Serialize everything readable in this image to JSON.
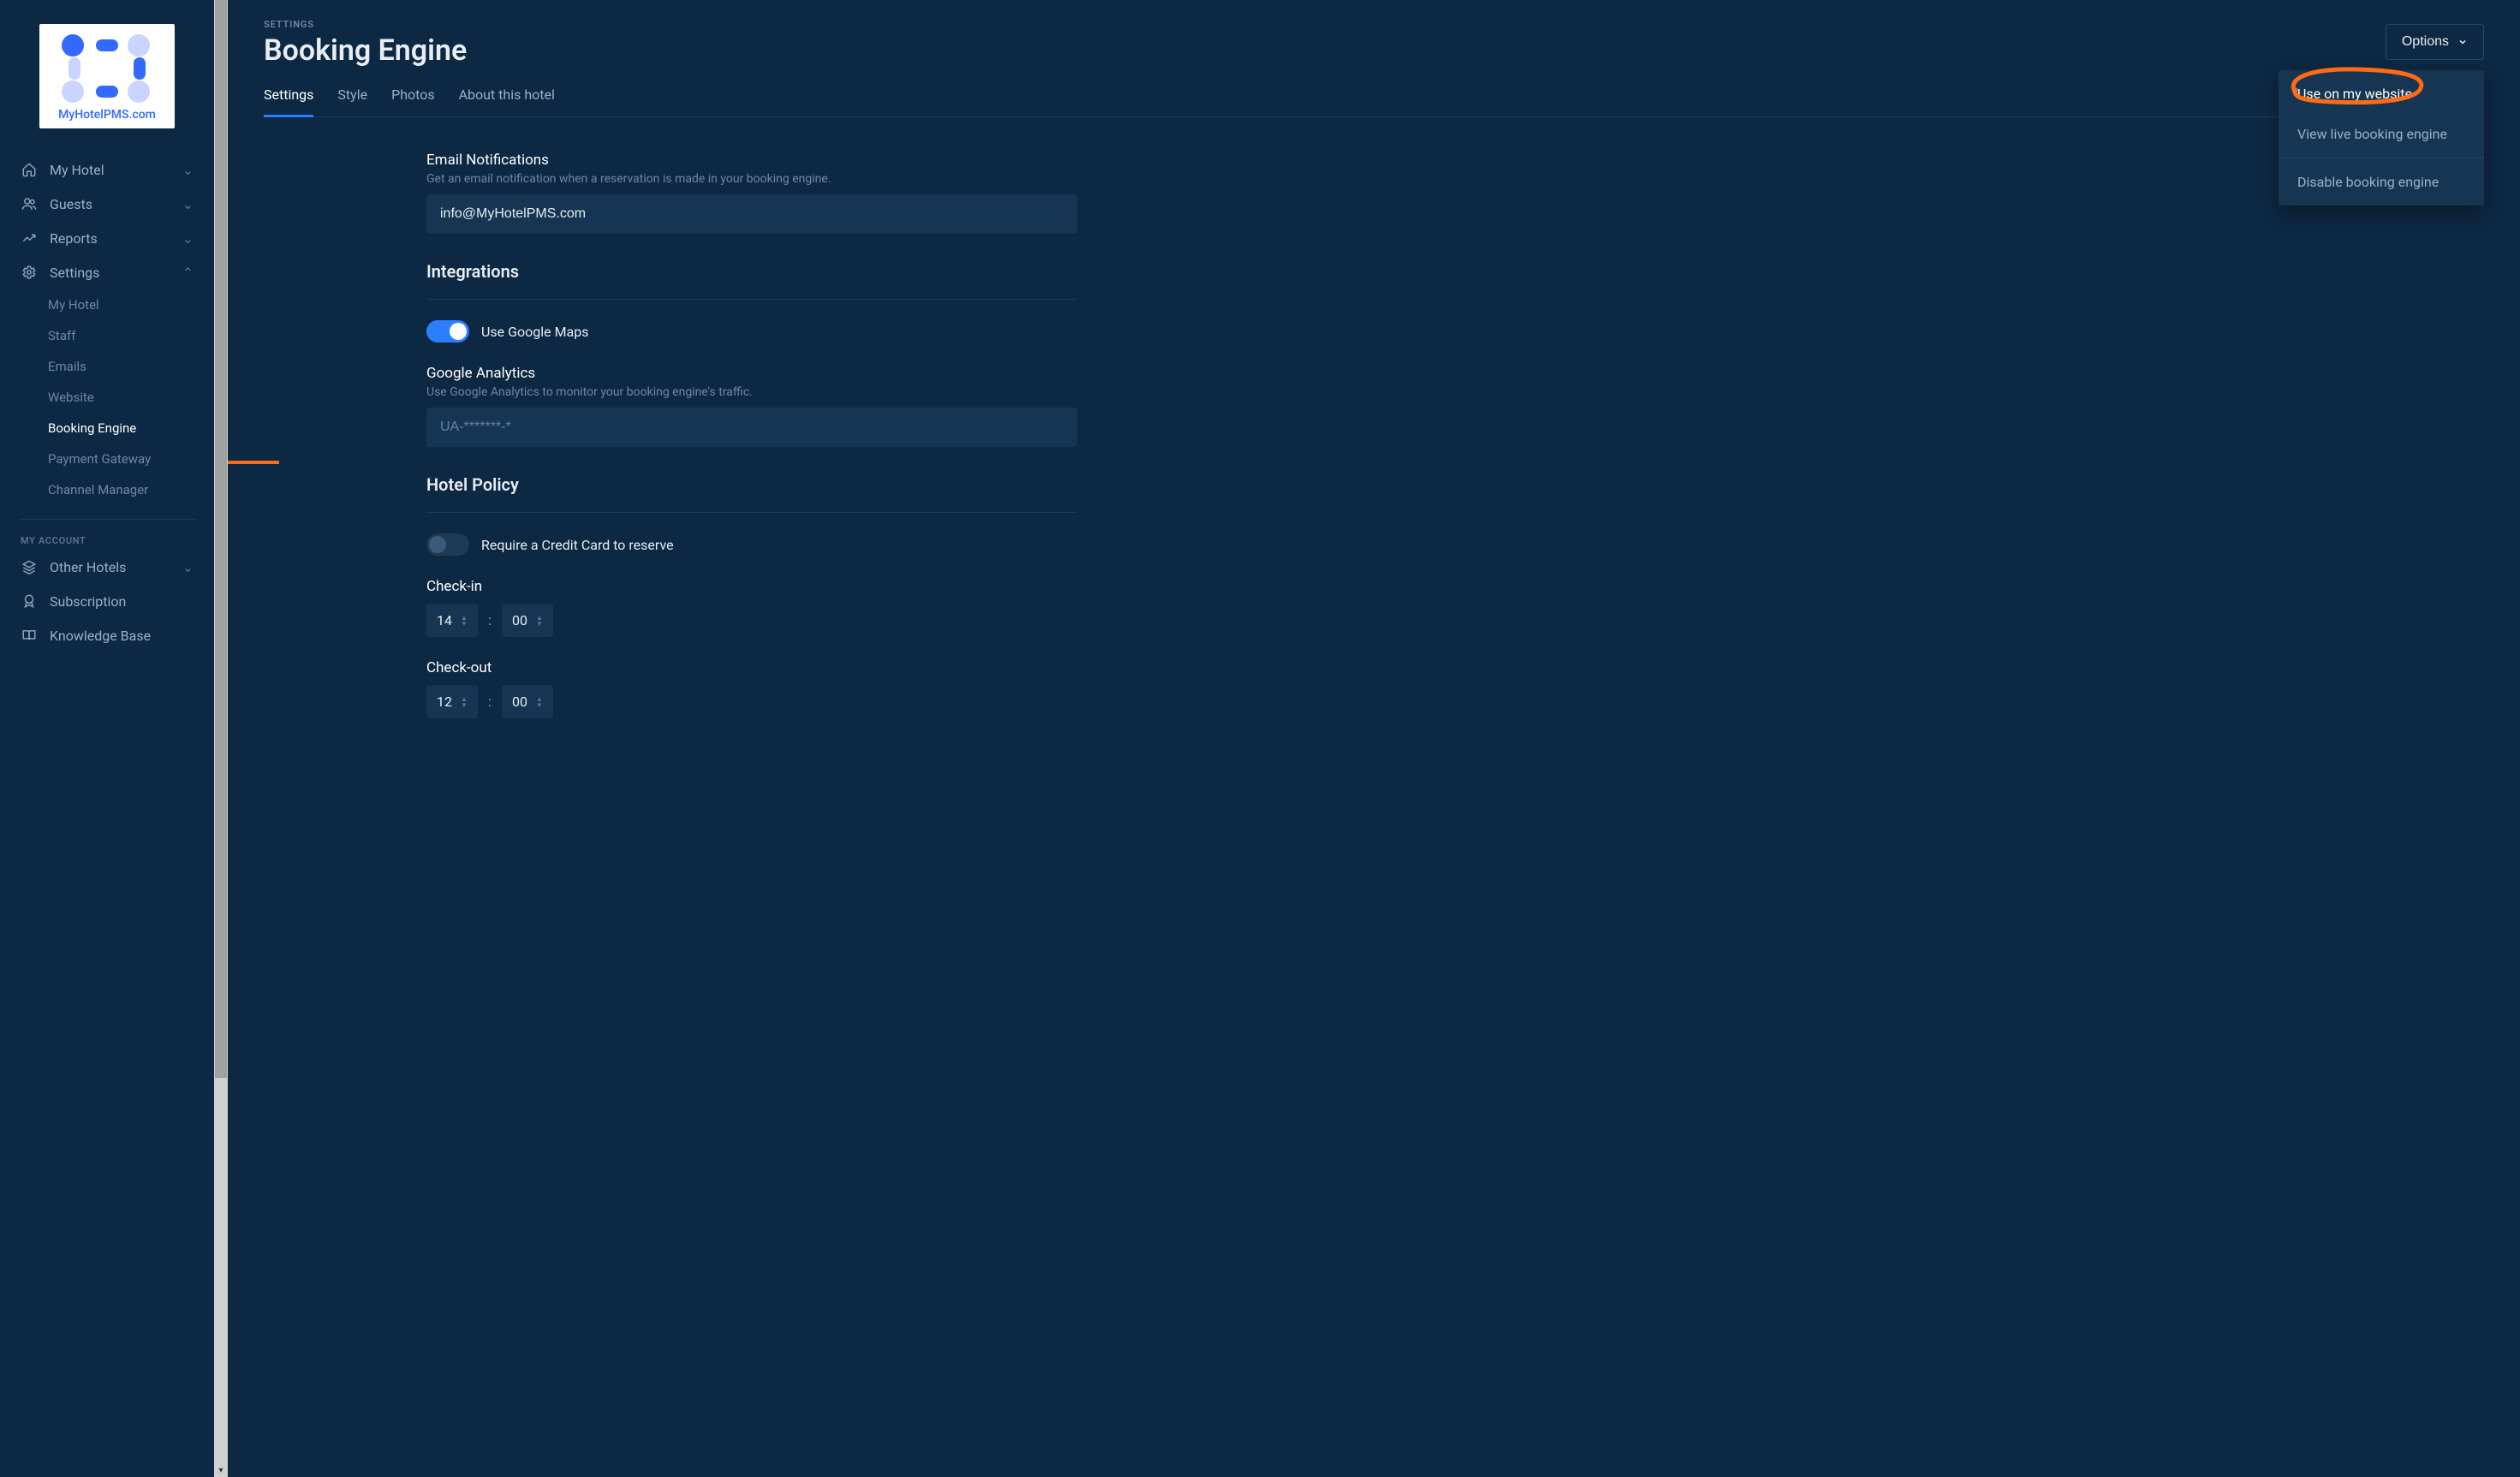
{
  "logo": {
    "text": "MyHotelPMS.com"
  },
  "sidebar": {
    "items": [
      {
        "label": "My Hotel",
        "icon": "home"
      },
      {
        "label": "Guests",
        "icon": "users"
      },
      {
        "label": "Reports",
        "icon": "trend"
      },
      {
        "label": "Settings",
        "icon": "gear"
      }
    ],
    "settings_sub": [
      {
        "label": "My Hotel"
      },
      {
        "label": "Staff"
      },
      {
        "label": "Emails"
      },
      {
        "label": "Website"
      },
      {
        "label": "Booking Engine"
      },
      {
        "label": "Payment Gateway"
      },
      {
        "label": "Channel Manager"
      }
    ],
    "my_account_label": "MY ACCOUNT",
    "account_items": [
      {
        "label": "Other Hotels",
        "icon": "layers"
      },
      {
        "label": "Subscription",
        "icon": "badge"
      },
      {
        "label": "Knowledge Base",
        "icon": "book"
      }
    ]
  },
  "header": {
    "breadcrumb": "SETTINGS",
    "title": "Booking Engine",
    "options_label": "Options",
    "options_menu": {
      "use_on_website": "Use on my website",
      "view_live": "View live booking engine",
      "disable": "Disable booking engine"
    }
  },
  "tabs": [
    {
      "label": "Settings"
    },
    {
      "label": "Style"
    },
    {
      "label": "Photos"
    },
    {
      "label": "About this hotel"
    }
  ],
  "form": {
    "email_notif": {
      "label": "Email Notifications",
      "help": "Get an email notification when a reservation is made in your booking engine.",
      "value": "info@MyHotelPMS.com"
    },
    "integrations_title": "Integrations",
    "google_maps_label": "Use Google Maps",
    "google_analytics": {
      "label": "Google Analytics",
      "help": "Use Google Analytics to monitor your booking engine's traffic.",
      "placeholder": "UA-*******-*"
    },
    "hotel_policy_title": "Hotel Policy",
    "require_cc_label": "Require a Credit Card to reserve",
    "checkin_label": "Check-in",
    "checkin": {
      "hour": "14",
      "minute": "00"
    },
    "checkout_label": "Check-out",
    "checkout": {
      "hour": "12",
      "minute": "00"
    }
  },
  "colors": {
    "accent": "#2b7fff",
    "annotation": "#ff6a13"
  }
}
